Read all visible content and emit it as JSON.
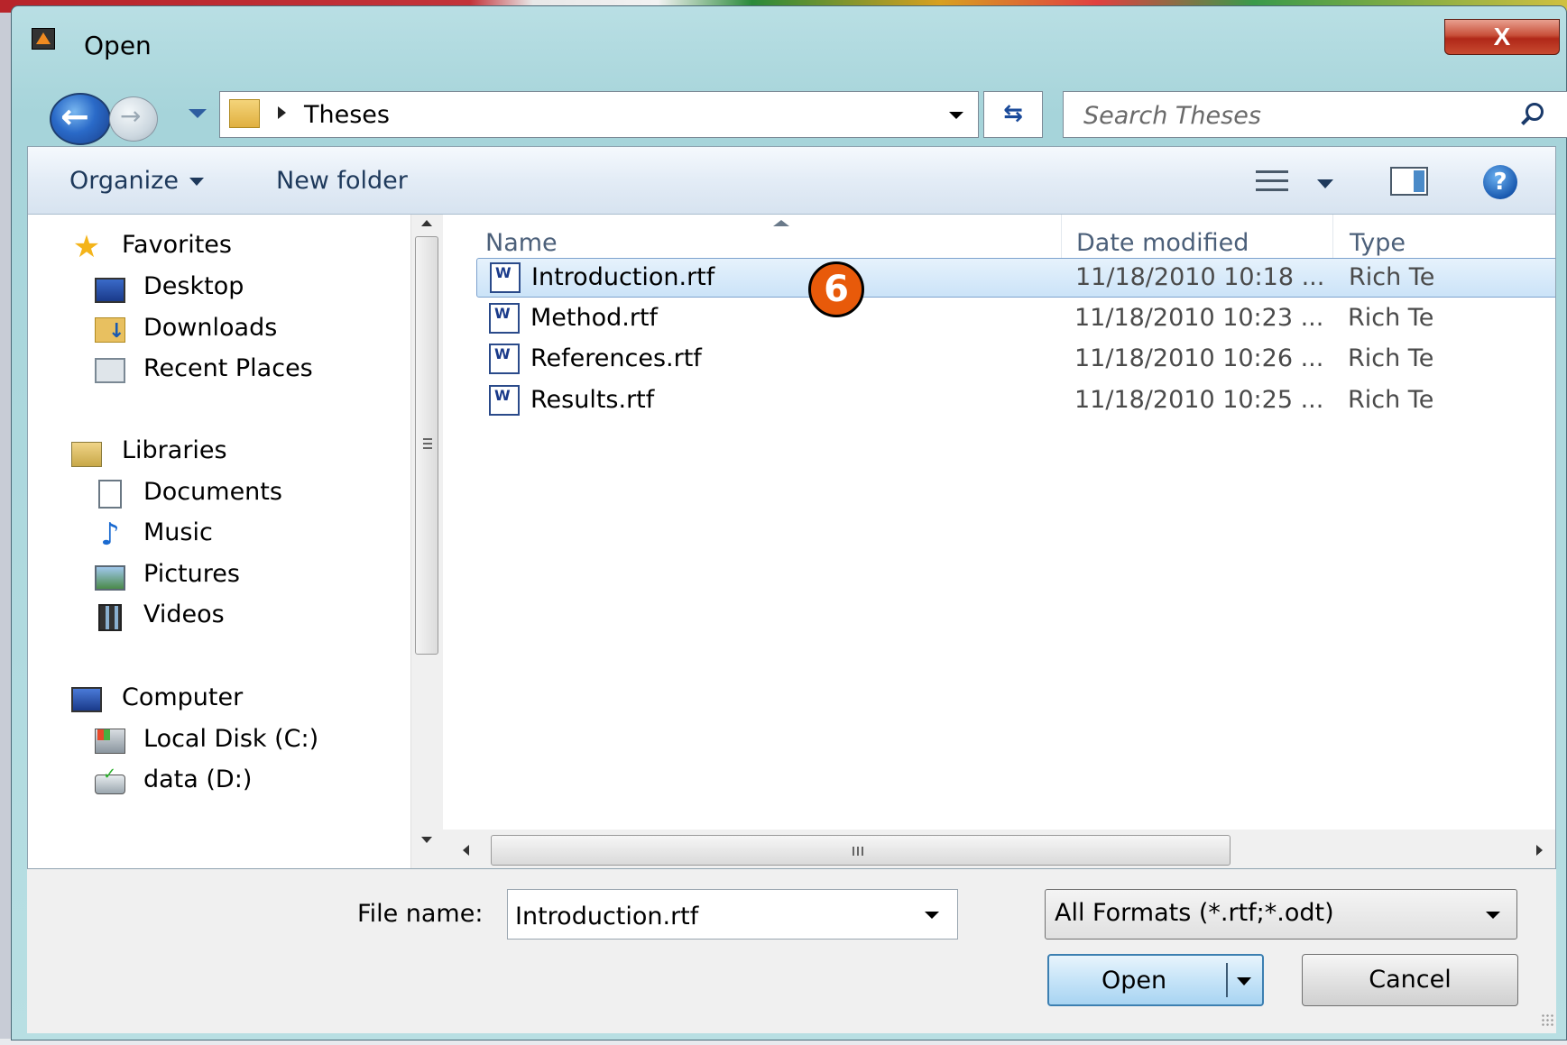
{
  "window": {
    "title": "Open",
    "close_label": "X"
  },
  "navigation": {
    "breadcrumb": "Theses",
    "search_placeholder": "Search Theses"
  },
  "toolbar": {
    "organize_label": "Organize",
    "new_folder_label": "New folder"
  },
  "sidebar": {
    "favorites": {
      "label": "Favorites",
      "items": [
        {
          "label": "Desktop",
          "icon": "desktop-icon"
        },
        {
          "label": "Downloads",
          "icon": "downloads-icon"
        },
        {
          "label": "Recent Places",
          "icon": "recent-places-icon"
        }
      ]
    },
    "libraries": {
      "label": "Libraries",
      "items": [
        {
          "label": "Documents",
          "icon": "documents-icon"
        },
        {
          "label": "Music",
          "icon": "music-icon"
        },
        {
          "label": "Pictures",
          "icon": "pictures-icon"
        },
        {
          "label": "Videos",
          "icon": "videos-icon"
        }
      ]
    },
    "computer": {
      "label": "Computer",
      "items": [
        {
          "label": "Local Disk (C:)",
          "icon": "local-disk-icon"
        },
        {
          "label": "data (D:)",
          "icon": "removable-drive-icon"
        }
      ]
    }
  },
  "file_list": {
    "columns": [
      "Name",
      "Date modified",
      "Type"
    ],
    "files": [
      {
        "name": "Introduction.rtf",
        "date": "11/18/2010 10:18 ...",
        "type": "Rich Te",
        "selected": true
      },
      {
        "name": "Method.rtf",
        "date": "11/18/2010 10:23 ...",
        "type": "Rich Te",
        "selected": false
      },
      {
        "name": "References.rtf",
        "date": "11/18/2010 10:26 ...",
        "type": "Rich Te",
        "selected": false
      },
      {
        "name": "Results.rtf",
        "date": "11/18/2010 10:25 ...",
        "type": "Rich Te",
        "selected": false
      }
    ],
    "hscroll_grip": "III"
  },
  "annotation": {
    "step_number": "6",
    "color": "#e85a0a"
  },
  "bottom": {
    "file_name_label": "File name:",
    "file_name_value": "Introduction.rtf",
    "file_type": "All Formats (*.rtf;*.odt)",
    "open_label": "Open",
    "cancel_label": "Cancel"
  },
  "colors": {
    "frame": "#a6d4da",
    "toolbar_text": "#1e395b",
    "selection_border": "#7da2ce",
    "close_button": "#c8503a"
  }
}
